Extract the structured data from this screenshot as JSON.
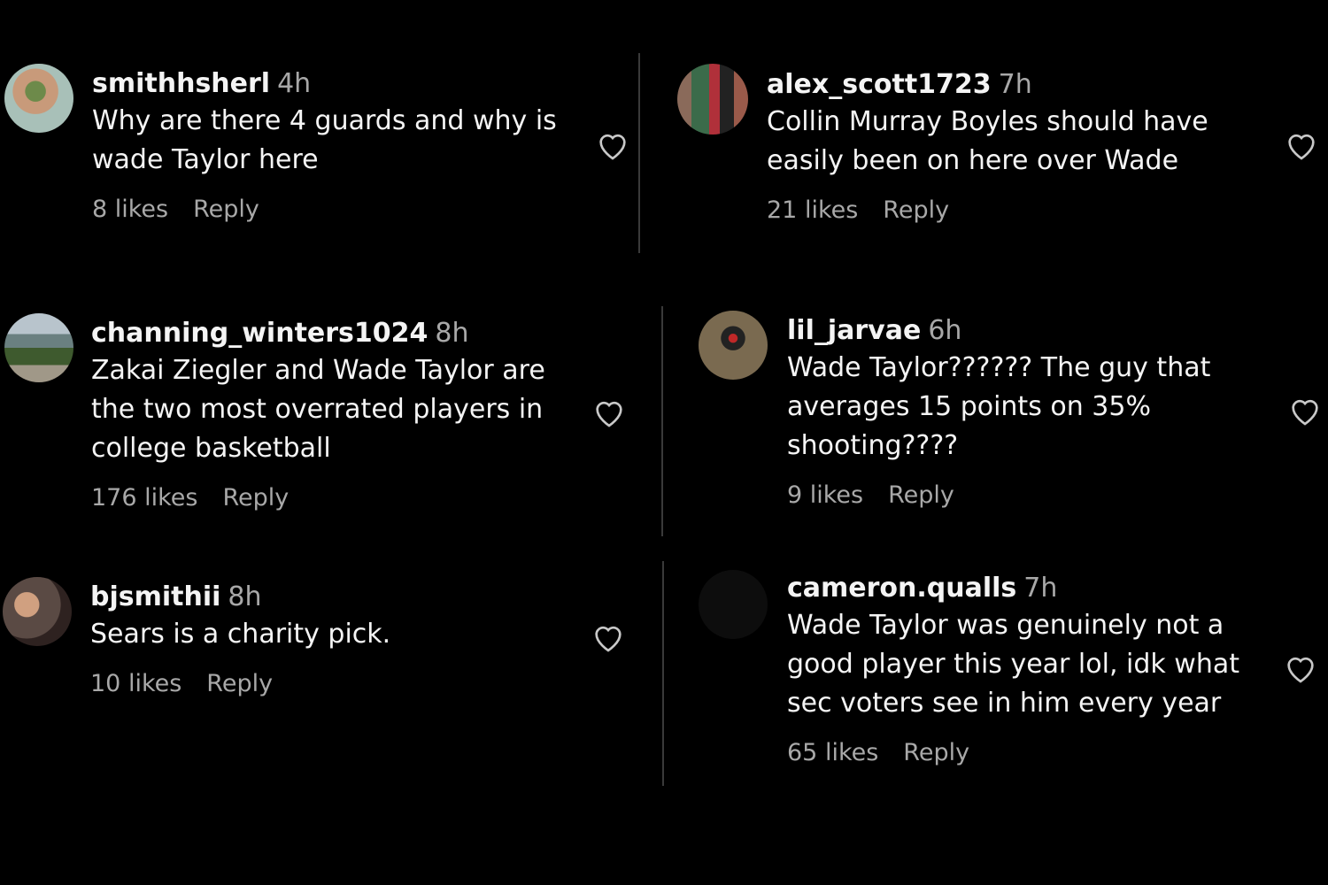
{
  "colors": {
    "background": "#000000",
    "username": "#f4f4f4",
    "secondary": "#a8a8a8",
    "divider": "#3a3a3a"
  },
  "comments": [
    {
      "username": "smithhsherl",
      "time": "4h",
      "text": "Why are there 4 guards and why is wade Taylor here",
      "likes": "8 likes",
      "reply": "Reply",
      "avatar": "avatar-photo"
    },
    {
      "username": "alex_scott1723",
      "time": "7h",
      "text": "Collin Murray Boyles should have easily been on here over Wade",
      "likes": "21 likes",
      "reply": "Reply",
      "avatar": "avatar-photo"
    },
    {
      "username": "channing_winters1024",
      "time": "8h",
      "text": "Zakai Ziegler and Wade Taylor are the two most overrated players in college basketball",
      "likes": "176 likes",
      "reply": "Reply",
      "avatar": "avatar-photo"
    },
    {
      "username": "lil_jarvae",
      "time": "6h",
      "text": "Wade Taylor?????? The guy that averages 15 points on 35% shooting????",
      "likes": "9 likes",
      "reply": "Reply",
      "avatar": "avatar-photo"
    },
    {
      "username": "bjsmithii",
      "time": "8h",
      "text": "Sears is a charity pick.",
      "likes": "10 likes",
      "reply": "Reply",
      "avatar": "avatar-photo"
    },
    {
      "username": "cameron.qualls",
      "time": "7h",
      "text": "Wade Taylor was genuinely not a good player this year lol, idk what sec voters see in him every year",
      "likes": "65 likes",
      "reply": "Reply",
      "avatar": "avatar-photo"
    }
  ],
  "icons": {
    "like": "heart-outline-icon"
  }
}
